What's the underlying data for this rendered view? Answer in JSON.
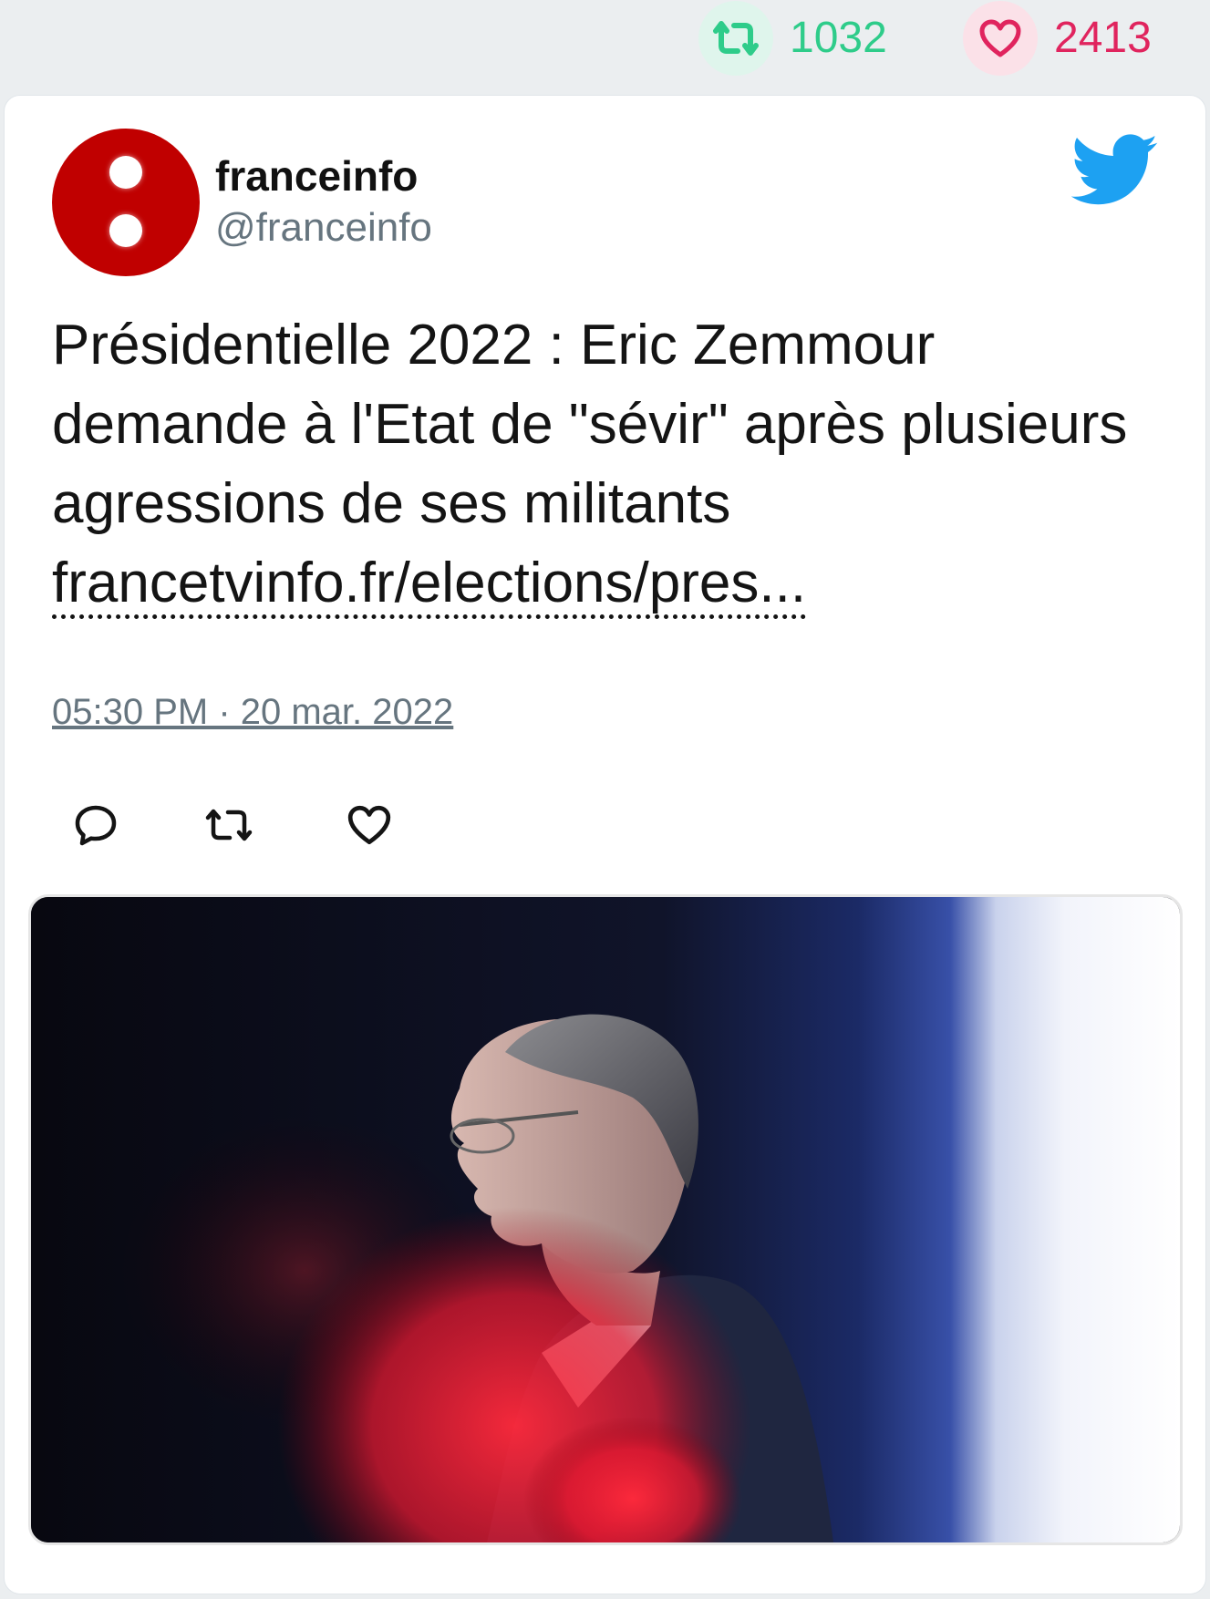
{
  "stats": {
    "retweets": "1032",
    "likes": "2413",
    "retweet_color": "#2ecc8a",
    "like_color": "#e0245e"
  },
  "author": {
    "name": "franceinfo",
    "handle": "@franceinfo",
    "avatar_color": "#c00000"
  },
  "tweet": {
    "text": "Présidentielle 2022 : Eric Zemmour demande à l'Etat de \"sévir\" après plusieurs agressions de ses militants",
    "link": "francetvinfo.fr/elections/pres...",
    "timestamp": "05:30 PM · 20 mar. 2022"
  },
  "icons": {
    "brand": "twitter-bird-icon",
    "reply": "reply-icon",
    "retweet": "retweet-icon",
    "like": "heart-icon"
  },
  "brand_color": "#1da1f2"
}
